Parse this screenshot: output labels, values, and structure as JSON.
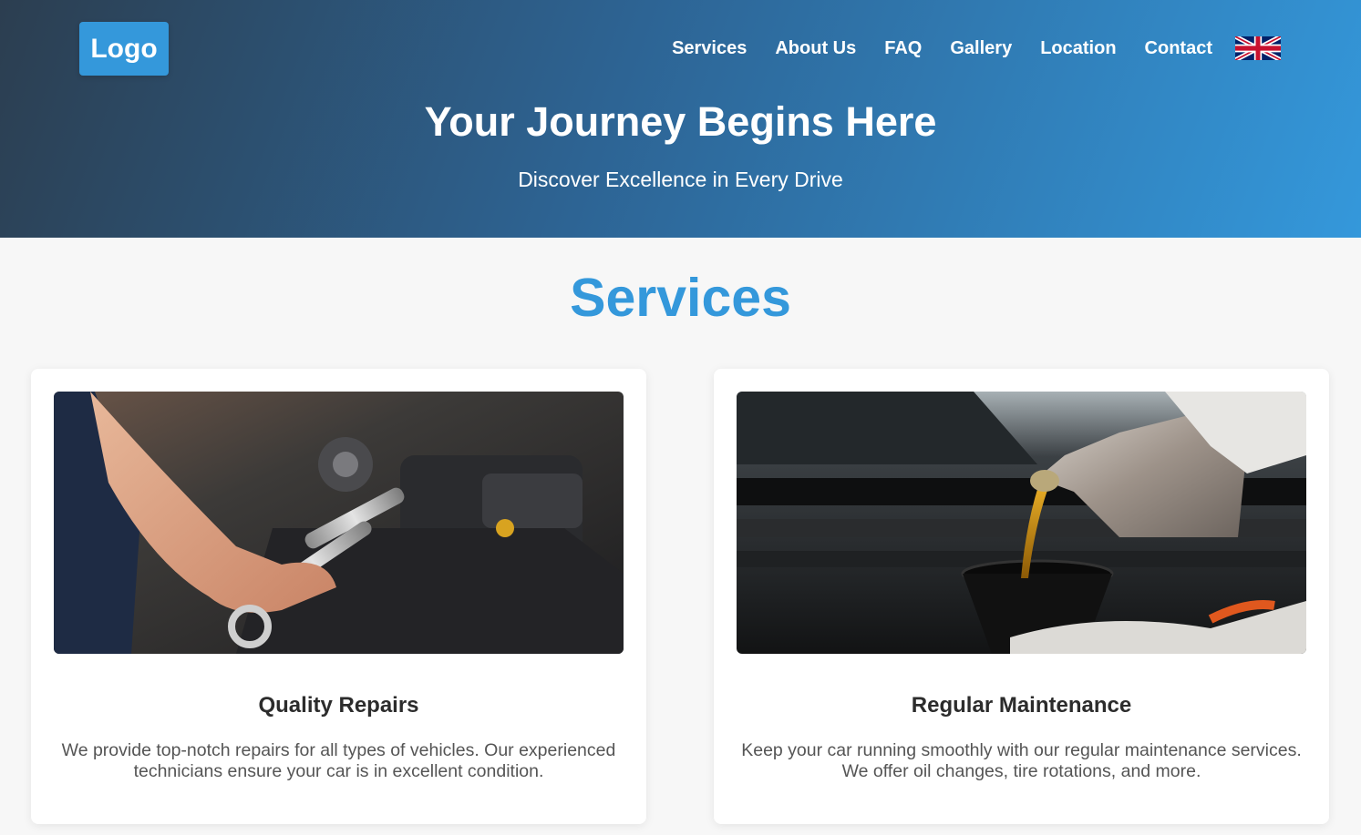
{
  "header": {
    "logo_text": "Logo",
    "nav": [
      {
        "label": "Services"
      },
      {
        "label": "About Us"
      },
      {
        "label": "FAQ"
      },
      {
        "label": "Gallery"
      },
      {
        "label": "Location"
      },
      {
        "label": "Contact"
      }
    ],
    "language_icon": "uk-flag-icon"
  },
  "hero": {
    "title": "Your Journey Begins Here",
    "subtitle": "Discover Excellence in Every Drive"
  },
  "services": {
    "title": "Services",
    "cards": [
      {
        "image": "mechanic-wrench-engine-photo",
        "title": "Quality Repairs",
        "text": "We provide top-notch repairs for all types of vehicles. Our experienced technicians ensure your car is in excellent condition."
      },
      {
        "image": "oil-pouring-engine-photo",
        "title": "Regular Maintenance",
        "text": "Keep your car running smoothly with our regular maintenance services. We offer oil changes, tire rotations, and more."
      }
    ]
  },
  "colors": {
    "accent": "#3498db",
    "header_dark": "#2c3e50"
  }
}
